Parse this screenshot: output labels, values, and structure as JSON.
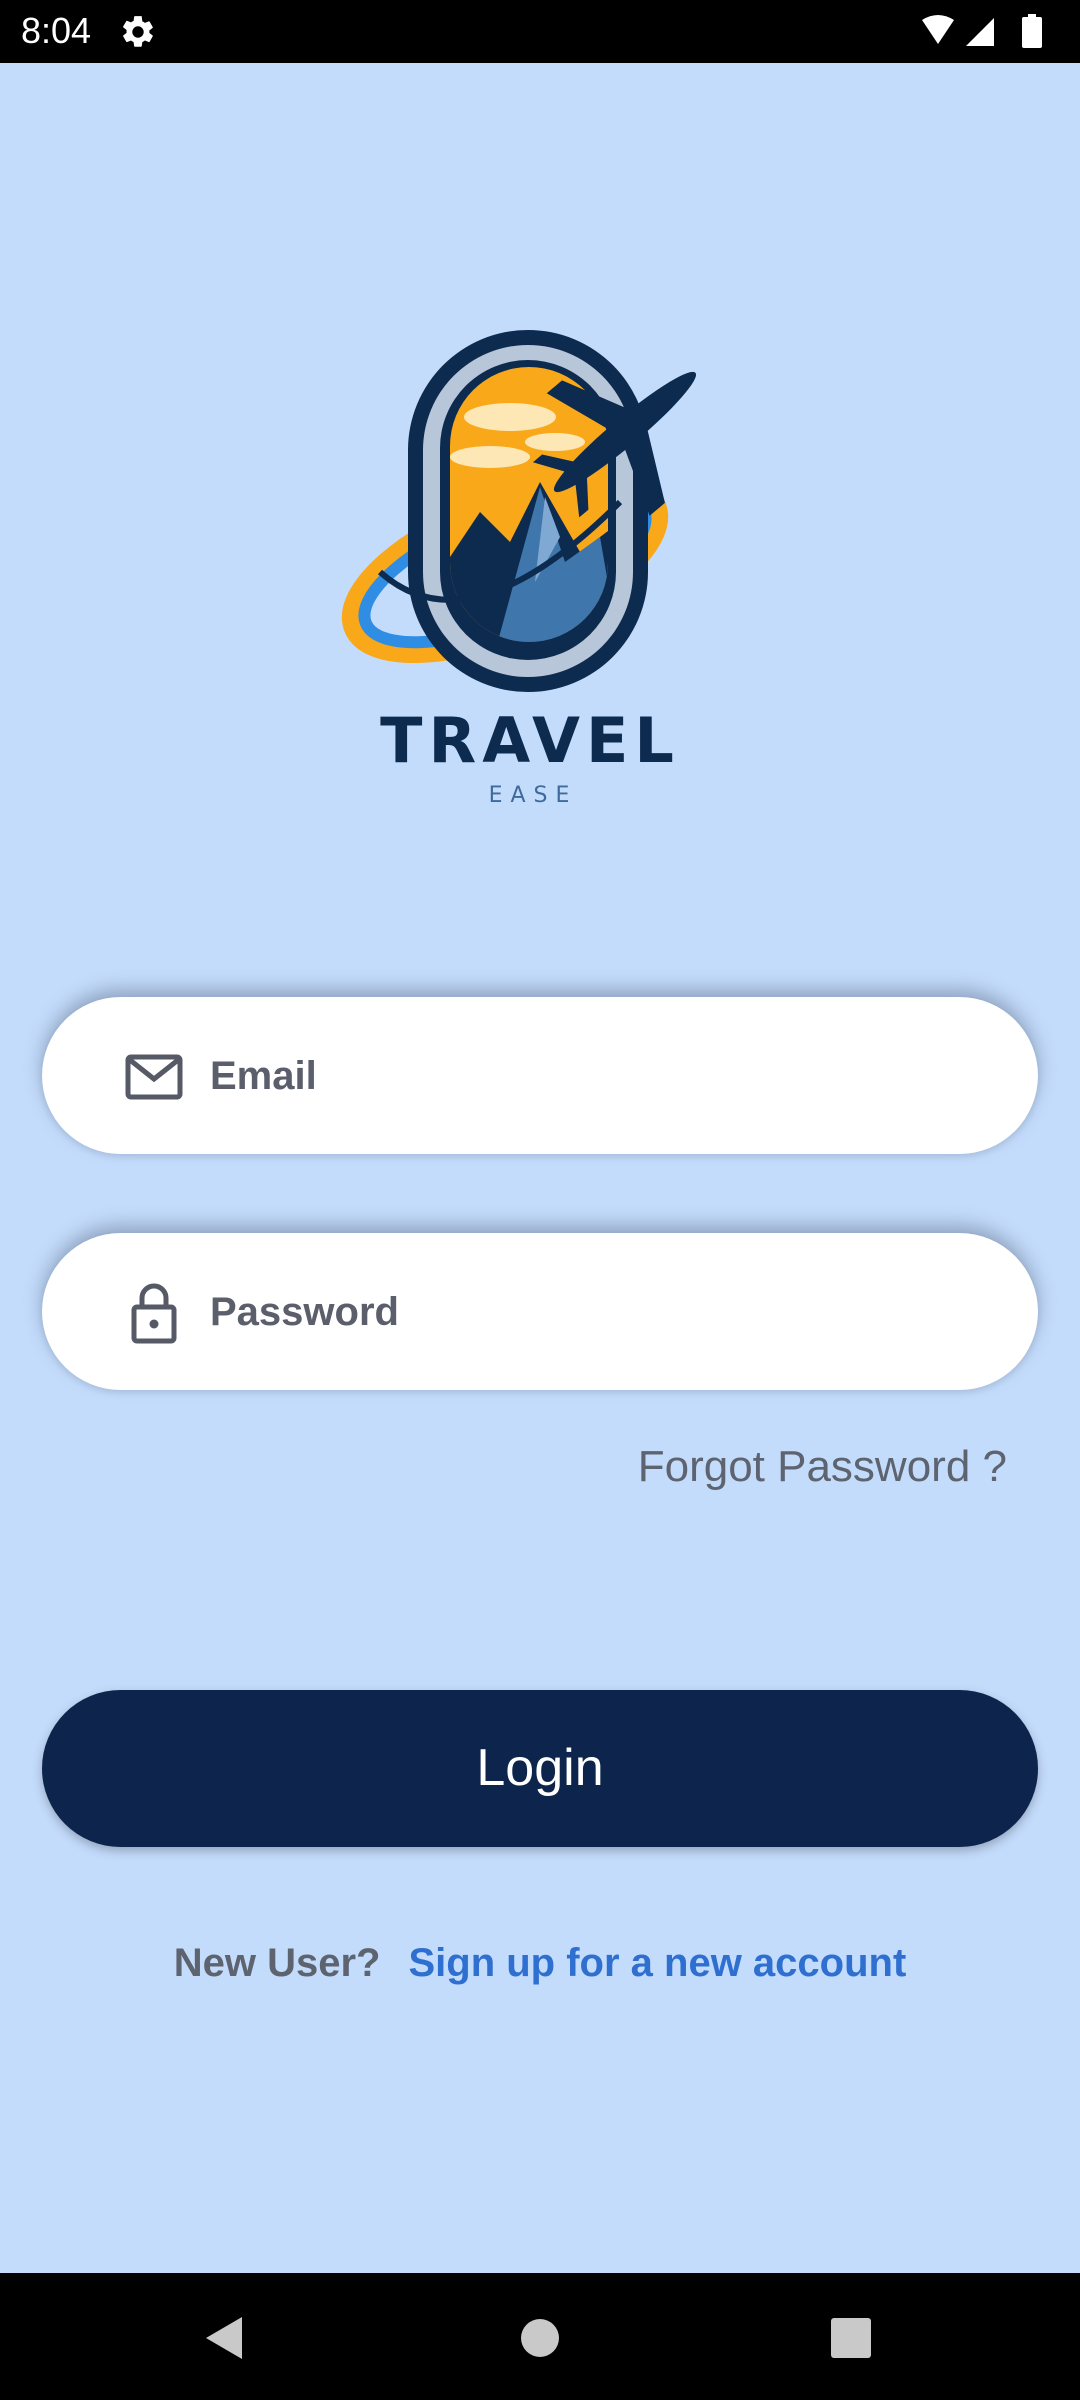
{
  "status_bar": {
    "time": "8:04",
    "icons": [
      "settings-gear-icon",
      "wifi-icon",
      "cellular-signal-icon",
      "battery-icon"
    ]
  },
  "logo": {
    "title": "TRAVEL",
    "subtitle": "EASE",
    "colors": {
      "navy": "#0d2a4f",
      "orange": "#f9a81a",
      "blue": "#2f8de4",
      "ring": "#b7c6d8"
    }
  },
  "form": {
    "email_placeholder": "Email",
    "email_icon": "mail-icon",
    "password_placeholder": "Password",
    "password_icon": "lock-icon",
    "forgot_password": "Forgot Password ?",
    "login_label": "Login",
    "new_user_text": "New User?",
    "signup_link": "Sign up for a new account"
  },
  "nav_bar": {
    "icons": [
      "back-icon",
      "home-icon",
      "recents-icon"
    ]
  },
  "colors": {
    "background": "#c4dcfc",
    "primary": "#0d254c",
    "link": "#2f6fd0",
    "muted_text": "#5d6470"
  }
}
